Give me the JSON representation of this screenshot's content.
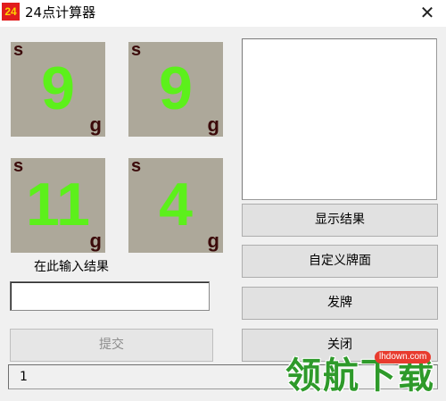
{
  "window": {
    "icon_text": "24",
    "title": "24点计算器",
    "close_glyph": "✕"
  },
  "cards": [
    {
      "top": "s",
      "value": "9",
      "bottom": "g"
    },
    {
      "top": "s",
      "value": "9",
      "bottom": "g"
    },
    {
      "top": "s",
      "value": "11",
      "bottom": "g"
    },
    {
      "top": "s",
      "value": "4",
      "bottom": "g"
    }
  ],
  "input_section": {
    "label": "在此输入结果",
    "value": "",
    "submit_label": "提交"
  },
  "buttons": {
    "show_result": "显示结果",
    "custom_cards": "自定义牌面",
    "deal": "发牌",
    "close": "关闭"
  },
  "status": {
    "text": "1"
  },
  "watermark": {
    "text": "领航下载",
    "badge": "lhdown.com"
  },
  "colors": {
    "card_bg": "#ada89a",
    "card_value": "#5cf01b",
    "card_corner": "#3b0a0a",
    "icon_bg": "#e11d1d",
    "icon_text": "#ffd400",
    "watermark_green": "#2e9a2a",
    "watermark_badge": "#e83b2e"
  }
}
